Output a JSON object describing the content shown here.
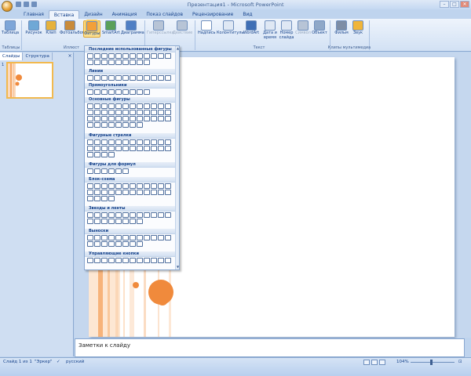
{
  "window": {
    "title": "Презентация1 - Microsoft PowerPoint",
    "controls": [
      "–",
      "□",
      "✕"
    ]
  },
  "tabs": [
    {
      "label": "Главная",
      "active": false
    },
    {
      "label": "Вставка",
      "active": true
    },
    {
      "label": "Дизайн",
      "active": false
    },
    {
      "label": "Анимация",
      "active": false
    },
    {
      "label": "Показ слайдов",
      "active": false
    },
    {
      "label": "Рецензирование",
      "active": false
    },
    {
      "label": "Вид",
      "active": false
    }
  ],
  "ribbon": {
    "buttons": [
      {
        "label": "Таблица",
        "icon": "table-icon",
        "color": "#7ea6d8"
      },
      {
        "label": "Рисунок",
        "icon": "picture-icon",
        "color": "#6fa8d6"
      },
      {
        "label": "Клип",
        "icon": "clip-icon",
        "color": "#e6b23c"
      },
      {
        "label": "Фотоальбом",
        "icon": "photo-album-icon",
        "color": "#c98b3a"
      },
      {
        "label": "Фигуры",
        "icon": "shapes-icon",
        "color": "#f2a03a"
      },
      {
        "label": "SmartArt",
        "icon": "smartart-icon",
        "color": "#5aa05a"
      },
      {
        "label": "Диаграмма",
        "icon": "chart-icon",
        "color": "#4f7fc4"
      },
      {
        "label": "Гиперссылка",
        "icon": "hyperlink-icon",
        "color": "#b7c4d6"
      },
      {
        "label": "Действие",
        "icon": "action-icon",
        "color": "#b7c4d6"
      },
      {
        "label": "Надпись",
        "icon": "textbox-icon",
        "color": "#ffffff"
      },
      {
        "label": "Колонтитулы",
        "icon": "header-footer-icon",
        "color": "#dfe8f4"
      },
      {
        "label": "WordArt",
        "icon": "wordart-icon",
        "color": "#3f6fb5"
      },
      {
        "label": "Дата и время",
        "icon": "datetime-icon",
        "color": "#dfe8f4"
      },
      {
        "label": "Номер слайда",
        "icon": "slide-number-icon",
        "color": "#dfe8f4"
      },
      {
        "label": "Символ",
        "icon": "symbol-icon",
        "color": "#b7c4d6"
      },
      {
        "label": "Объект",
        "icon": "object-icon",
        "color": "#8fa8c8"
      },
      {
        "label": "Фильм",
        "icon": "movie-icon",
        "color": "#7d8da5"
      },
      {
        "label": "Звук",
        "icon": "sound-icon",
        "color": "#f0b53a"
      }
    ],
    "groups": [
      "Таблицы",
      "Иллюст",
      "Текст",
      "Клипы мультимедиа"
    ]
  },
  "left_panel": {
    "tabs": [
      "Слайды",
      "Структура"
    ],
    "close": "×",
    "slide_number": "1"
  },
  "dropdown": {
    "sections": [
      {
        "title": "Последние использованные фигуры",
        "count": 21
      },
      {
        "title": "Линии",
        "count": 12
      },
      {
        "title": "Прямоугольники",
        "count": 9
      },
      {
        "title": "Основные фигуры",
        "count": 44
      },
      {
        "title": "Фигурные стрелки",
        "count": 28
      },
      {
        "title": "Фигуры для формул",
        "count": 6
      },
      {
        "title": "Блок-схема",
        "count": 28
      },
      {
        "title": "Звезды и ленты",
        "count": 20
      },
      {
        "title": "Выноски",
        "count": 20
      },
      {
        "title": "Управляющие кнопки",
        "count": 12
      }
    ]
  },
  "notes": {
    "placeholder": "Заметки к слайду"
  },
  "status": {
    "slide": "Слайд 1 из 1",
    "theme": "\"Эркер\"",
    "language": "русский",
    "zoom": "104%"
  },
  "colors": {
    "accent": "#f2b94e",
    "slide_orange": "#f08a3c",
    "ribbon_bg": "#dfe9f7"
  }
}
